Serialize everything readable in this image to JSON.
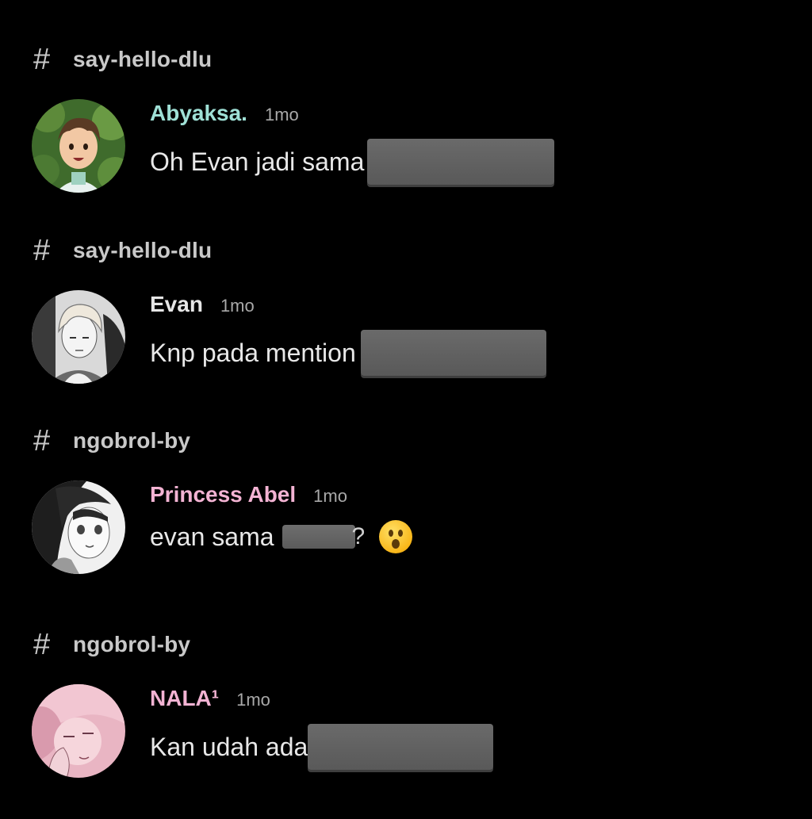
{
  "results": [
    {
      "channel": "say-hello-dlu",
      "author": "Abyaksa.",
      "author_color": "#9fe0d6",
      "time": "1mo",
      "text": "Oh Evan jadi sama",
      "avatar": "anime-boy-brown-hair-avatar"
    },
    {
      "channel": "say-hello-dlu",
      "author": "Evan",
      "author_color": "#e6e6e6",
      "time": "1mo",
      "text": "Knp pada mention",
      "avatar": "monochrome-boy-avatar"
    },
    {
      "channel": "ngobrol-by",
      "author": "Princess Abel",
      "author_color": "#f3b3d3",
      "time": "1mo",
      "text": "evan sama",
      "text_suffix": "?",
      "emoji": "astonished-face-emoji",
      "avatar": "manga-girl-avatar"
    },
    {
      "channel": "ngobrol-by",
      "author": "NALA¹",
      "author_color": "#f3b3d3",
      "time": "1mo",
      "text": "Kan udah ada",
      "avatar": "pink-anime-avatar"
    }
  ],
  "icons": {
    "channel": "hash-icon",
    "redaction": "redacted-block"
  }
}
